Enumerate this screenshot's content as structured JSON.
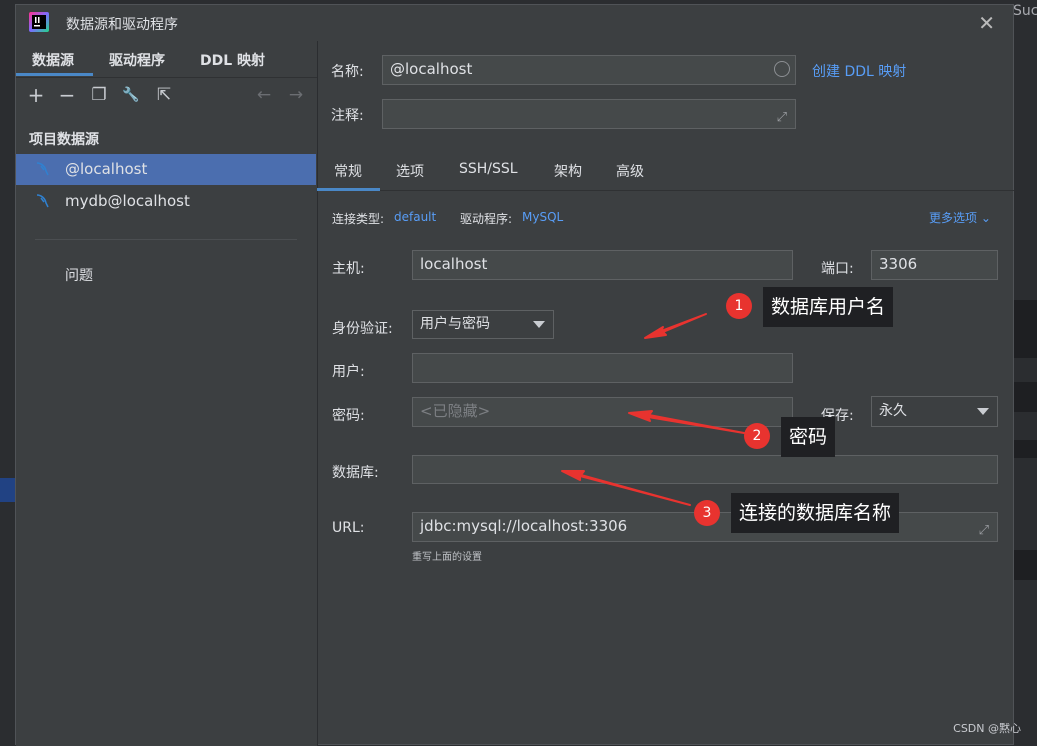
{
  "background": {
    "partial_text": "Suc"
  },
  "window": {
    "title": "数据源和驱动程序",
    "close_glyph": "✕"
  },
  "left": {
    "tabs": [
      "数据源",
      "驱动程序",
      "DDL 映射"
    ],
    "toolbar": {
      "add": "+",
      "remove": "−",
      "copy": "❐",
      "settings": "🔧",
      "jump": "⇱",
      "back": "←",
      "forward": "→"
    },
    "section_title": "项目数据源",
    "items": [
      {
        "label": "@localhost",
        "selected": true
      },
      {
        "label": "mydb@localhost",
        "selected": false
      }
    ],
    "problems": "问题"
  },
  "right": {
    "name_label": "名称:",
    "name_value": "@localhost",
    "create_ddl": "创建 DDL 映射",
    "comment_label": "注释:",
    "comment_value": "",
    "tabs": [
      "常规",
      "选项",
      "SSH/SSL",
      "架构",
      "高级"
    ],
    "conn_type_label": "连接类型:",
    "conn_type_value": "default",
    "driver_label": "驱动程序:",
    "driver_value": "MySQL",
    "more_options": "更多选项",
    "host_label": "主机:",
    "host_value": "localhost",
    "port_label": "端口:",
    "port_value": "3306",
    "auth_label": "身份验证:",
    "auth_value": "用户与密码",
    "user_label": "用户:",
    "user_value": "",
    "password_label": "密码:",
    "password_placeholder": "<已隐藏>",
    "save_label": "保存:",
    "save_value": "永久",
    "database_label": "数据库:",
    "database_value": "",
    "url_label": "URL:",
    "url_value": "jdbc:mysql://localhost:3306",
    "url_hint": "重写上面的设置"
  },
  "annotations": [
    {
      "number": "1",
      "text": "数据库用户名"
    },
    {
      "number": "2",
      "text": "密码"
    },
    {
      "number": "3",
      "text": "连接的数据库名称"
    }
  ],
  "colors": {
    "accent": "#4a88c7",
    "selection": "#4b6eaf",
    "link": "#589df6",
    "badge": "#e8332f",
    "arrow": "#e8332f"
  },
  "watermark": "CSDN @黙心"
}
